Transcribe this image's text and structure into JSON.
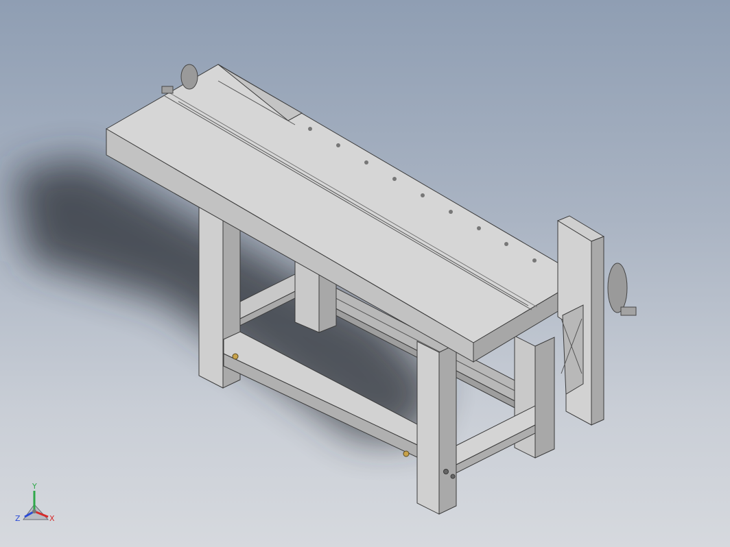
{
  "viewport": {
    "background_top": "#8f9eb3",
    "background_bottom": "#d6d9de",
    "model": "workbench-with-leg-vise-and-end-vise"
  },
  "triad": {
    "y_label": "Y",
    "z_label": "Z",
    "x_label": "X",
    "y_color": "#2fa84a",
    "z_color": "#2b4bd6",
    "x_color": "#d62b2b"
  }
}
